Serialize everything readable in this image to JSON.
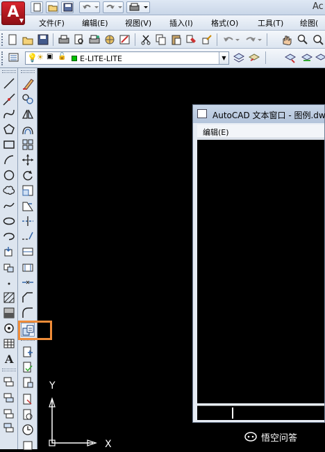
{
  "app": {
    "logo_letter": "A",
    "title_fragment": "Ac"
  },
  "menu": [
    "文件(F)",
    "编辑(E)",
    "视图(V)",
    "插入(I)",
    "格式(O)",
    "工具(T)",
    "绘图("
  ],
  "layers": {
    "current_layer": "E-LITE-LITE",
    "swatch_color": "#00c000"
  },
  "text_window": {
    "title": "AutoCAD 文本窗口 - 图例.dw",
    "menu_edit": "编辑(E)"
  },
  "ucs": {
    "x_label": "X",
    "y_label": "Y"
  },
  "watermark": {
    "text": "悟空问答"
  },
  "highlight_color": "#f08c38"
}
